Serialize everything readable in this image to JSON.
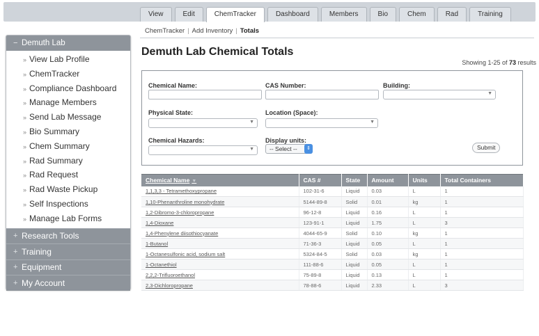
{
  "tabs": [
    {
      "label": "View"
    },
    {
      "label": "Edit"
    },
    {
      "label": "ChemTracker",
      "active": true
    },
    {
      "label": "Dashboard"
    },
    {
      "label": "Members"
    },
    {
      "label": "Bio"
    },
    {
      "label": "Chem"
    },
    {
      "label": "Rad"
    },
    {
      "label": "Training"
    }
  ],
  "sidebar": {
    "expanded": {
      "label": "Demuth Lab",
      "marker": "−",
      "items": [
        {
          "label": "View Lab Profile"
        },
        {
          "label": "ChemTracker"
        },
        {
          "label": "Compliance Dashboard"
        },
        {
          "label": "Manage Members"
        },
        {
          "label": "Send Lab Message"
        },
        {
          "label": "Bio Summary"
        },
        {
          "label": "Chem Summary"
        },
        {
          "label": "Rad Summary"
        },
        {
          "label": "Rad Request"
        },
        {
          "label": "Rad Waste Pickup"
        },
        {
          "label": "Self Inspections"
        },
        {
          "label": "Manage Lab Forms"
        }
      ],
      "item_marker": "»"
    },
    "sections": [
      {
        "label": "Research Tools",
        "marker": "+"
      },
      {
        "label": "Training",
        "marker": "+"
      },
      {
        "label": "Equipment",
        "marker": "+"
      },
      {
        "label": "My Account",
        "marker": "+"
      }
    ]
  },
  "breadcrumb": {
    "items": [
      "ChemTracker",
      "Add Inventory"
    ],
    "separator": "|",
    "current": "Totals"
  },
  "page": {
    "title": "Demuth Lab Chemical Totals",
    "showing_prefix": "Showing 1-25 of ",
    "showing_total": "73",
    "showing_suffix": " results"
  },
  "filters": {
    "chemical_name_label": "Chemical Name:",
    "chemical_name_value": "",
    "cas_number_label": "CAS Number:",
    "cas_number_value": "",
    "building_label": "Building:",
    "building_value": "",
    "physical_state_label": "Physical State:",
    "physical_state_value": "",
    "location_label": "Location (Space):",
    "location_value": "",
    "hazards_label": "Chemical Hazards:",
    "hazards_value": "",
    "display_units_label": "Display units:",
    "display_units_value": "-- Select --",
    "submit_label": "Submit",
    "select_arrow": "▼",
    "stepper_glyph": "⇕"
  },
  "table": {
    "columns": [
      "Chemical Name",
      "CAS #",
      "State",
      "Amount",
      "Units",
      "Total Containers"
    ],
    "sort_indicator": "▼",
    "rows": [
      [
        "1,1,3,3 - Tetramethoxypropane",
        "102-31-6",
        "Liquid",
        "0.03",
        "L",
        "1"
      ],
      [
        "1,10-Phenanthroline monohydrate",
        "5144-89-8",
        "Solid",
        "0.01",
        "kg",
        "1"
      ],
      [
        "1,2-Dibromo-3-chloropropane",
        "96-12-8",
        "Liquid",
        "0.16",
        "L",
        "1"
      ],
      [
        "1,4-Dioxane",
        "123-91-1",
        "Liquid",
        "1.75",
        "L",
        "3"
      ],
      [
        "1,4-Phenylene diisothiocyanate",
        "4044-65-9",
        "Solid",
        "0.10",
        "kg",
        "1"
      ],
      [
        "1-Butanol",
        "71-36-3",
        "Liquid",
        "0.05",
        "L",
        "1"
      ],
      [
        "1-Octanesulfonic acid, sodium salt",
        "5324-84-5",
        "Solid",
        "0.03",
        "kg",
        "1"
      ],
      [
        "1-Octanethiol",
        "111-88-6",
        "Liquid",
        "0.05",
        "L",
        "1"
      ],
      [
        "2,2,2-Trifluoroethanol",
        "75-89-8",
        "Liquid",
        "0.13",
        "L",
        "1"
      ],
      [
        "2,3-Dichloropropane",
        "78-88-6",
        "Liquid",
        "2.33",
        "L",
        "3"
      ]
    ]
  }
}
